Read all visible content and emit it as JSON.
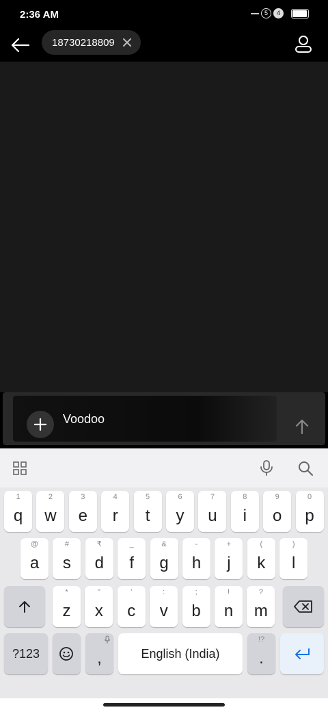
{
  "status_bar": {
    "time": "2:36 AM",
    "sim1": "5",
    "sim2": "4",
    "battery_level": 0.95
  },
  "header": {
    "recipient": "18730218809"
  },
  "composer": {
    "text": "Voodoo"
  },
  "keyboard": {
    "row1": [
      {
        "hint": "1",
        "key": "q"
      },
      {
        "hint": "2",
        "key": "w"
      },
      {
        "hint": "3",
        "key": "e"
      },
      {
        "hint": "4",
        "key": "r"
      },
      {
        "hint": "5",
        "key": "t"
      },
      {
        "hint": "6",
        "key": "y"
      },
      {
        "hint": "7",
        "key": "u"
      },
      {
        "hint": "8",
        "key": "i"
      },
      {
        "hint": "9",
        "key": "o"
      },
      {
        "hint": "0",
        "key": "p"
      }
    ],
    "row2": [
      {
        "hint": "@",
        "key": "a"
      },
      {
        "hint": "#",
        "key": "s"
      },
      {
        "hint": "₹",
        "key": "d"
      },
      {
        "hint": "_",
        "key": "f"
      },
      {
        "hint": "&",
        "key": "g"
      },
      {
        "hint": "-",
        "key": "h"
      },
      {
        "hint": "+",
        "key": "j"
      },
      {
        "hint": "(",
        "key": "k"
      },
      {
        "hint": ")",
        "key": "l"
      }
    ],
    "row3": [
      {
        "hint": "*",
        "key": "z"
      },
      {
        "hint": "\"",
        "key": "x"
      },
      {
        "hint": "'",
        "key": "c"
      },
      {
        "hint": ":",
        "key": "v"
      },
      {
        "hint": ";",
        "key": "b"
      },
      {
        "hint": "!",
        "key": "n"
      },
      {
        "hint": "?",
        "key": "m"
      }
    ],
    "symbols_label": "?123",
    "comma_label": ",",
    "space_label": "English (India)",
    "period_hint": "!?",
    "period_label": "."
  }
}
